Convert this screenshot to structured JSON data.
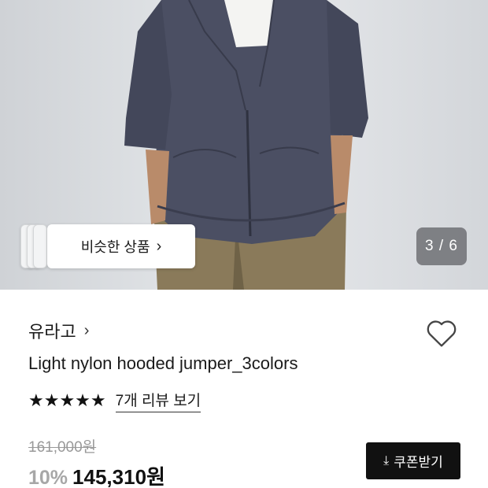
{
  "gallery": {
    "counter": "3 / 6",
    "similar_label": "비슷한 상품",
    "similar_chevron": "›"
  },
  "product": {
    "brand": "유라고",
    "brand_chevron": "›",
    "name": "Light nylon hooded jumper_3colors",
    "rating_stars": 5,
    "stars_text": "★★★★★",
    "review_link": "7개 리뷰 보기",
    "original_price": "161,000원",
    "discount": "10%",
    "sale_price": "145,310원"
  },
  "actions": {
    "coupon_label": "쿠폰받기",
    "coupon_icon": "download-icon",
    "wishlist_icon": "heart-icon"
  },
  "colors": {
    "coupon_bg": "#111111",
    "discount_text": "#a7a7a7",
    "jacket": "#4b4f63"
  }
}
